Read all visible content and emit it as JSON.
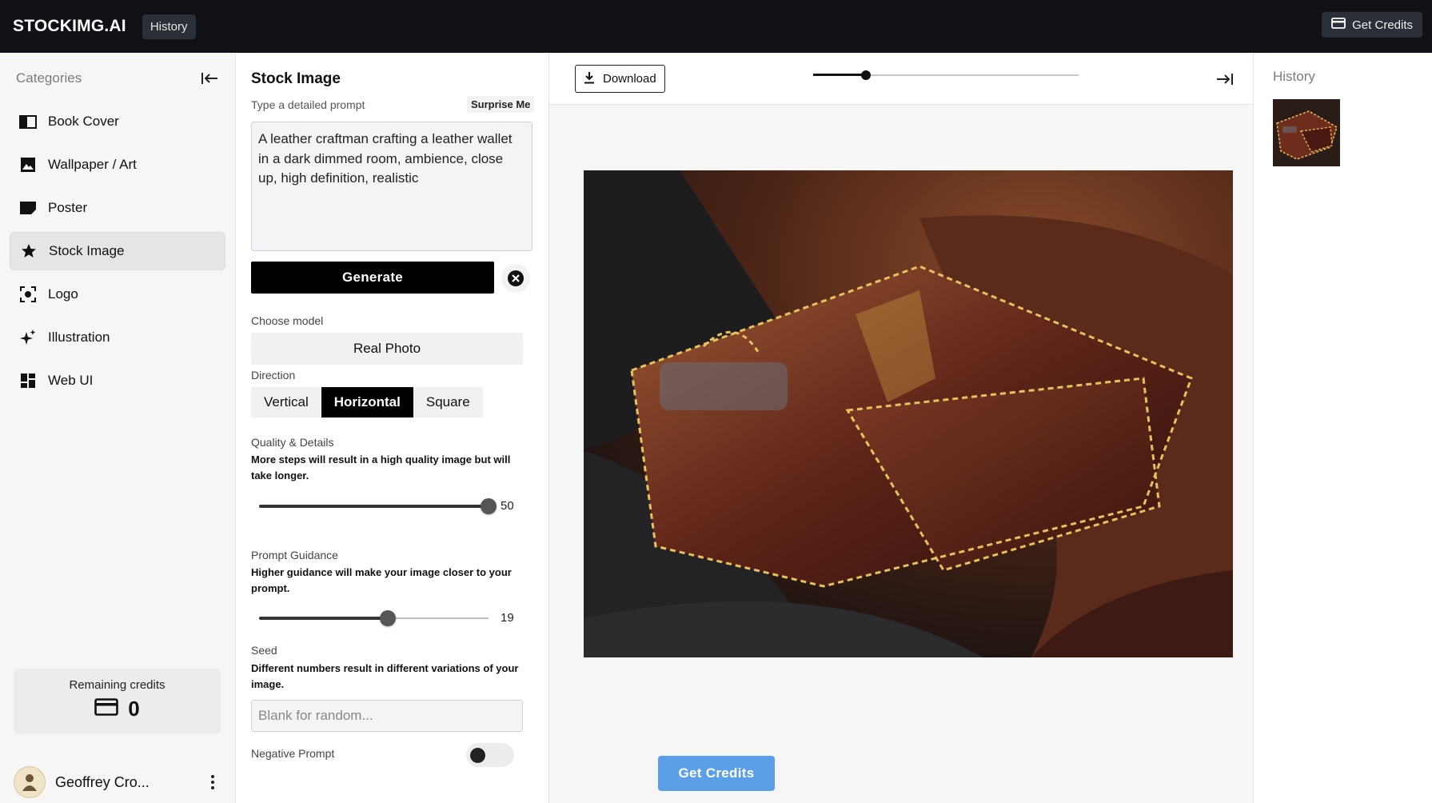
{
  "app": {
    "brand": "STOCKIMG.AI",
    "history_button": "History",
    "get_credits": "Get Credits"
  },
  "sidebar": {
    "title": "Categories",
    "items": [
      {
        "label": "Book Cover",
        "icon": "book-icon"
      },
      {
        "label": "Wallpaper / Art",
        "icon": "image-icon"
      },
      {
        "label": "Poster",
        "icon": "flag-icon"
      },
      {
        "label": "Stock Image",
        "icon": "star-icon",
        "active": true
      },
      {
        "label": "Logo",
        "icon": "focus-icon"
      },
      {
        "label": "Illustration",
        "icon": "sparkle-icon"
      },
      {
        "label": "Web UI",
        "icon": "grid-icon"
      }
    ],
    "credits_label": "Remaining credits",
    "credits_value": "0",
    "user_name": "Geoffrey Cro..."
  },
  "panel": {
    "title": "Stock Image",
    "prompt_label": "Type a detailed prompt",
    "surprise_label": "Surprise Me",
    "prompt_value": "A leather craftman crafting a leather wallet in a dark dimmed room, ambience, close up, high definition, realistic",
    "generate_label": "Generate",
    "model_label": "Choose model",
    "model_value": "Real Photo",
    "direction_label": "Direction",
    "directions": [
      "Vertical",
      "Horizontal",
      "Square"
    ],
    "direction_selected": "Horizontal",
    "quality_label": "Quality & Details",
    "quality_help": "More steps will result in a high quality image but will take longer.",
    "quality_value": "50",
    "quality_fraction": 1.0,
    "guidance_label": "Prompt Guidance",
    "guidance_help": "Higher guidance will make your image closer to your prompt.",
    "guidance_value": "19",
    "guidance_fraction": 0.56,
    "seed_label": "Seed",
    "seed_help": "Different numbers result in different variations of your image.",
    "seed_placeholder": "Blank for random...",
    "negative_label": "Negative Prompt",
    "negative_enabled": false
  },
  "preview": {
    "download_label": "Download",
    "zoom_fraction": 0.2,
    "get_credits_label": "Get Credits"
  },
  "history": {
    "title": "History"
  },
  "colors": {
    "topbar": "#0f1117",
    "accent_blue": "#5b9fe8",
    "selected": "#000000"
  }
}
